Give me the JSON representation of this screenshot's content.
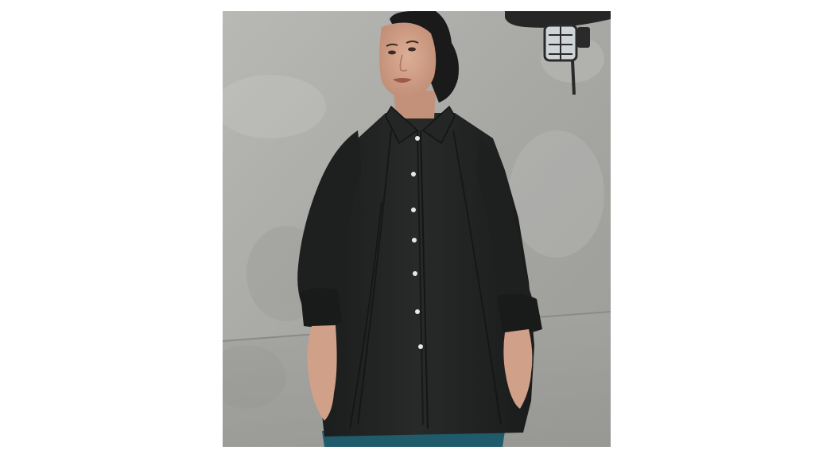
{
  "image": {
    "kind": "product-photo",
    "colors": {
      "page_background": "#ffffff",
      "wall": "#a9a9a7",
      "wall_light": "#c2c2bf",
      "wall_shadow": "#8f8f8d",
      "shirt": "#1f2220",
      "shirt_highlight": "#2f3330",
      "skin": "#d4a48c",
      "skin_shadow": "#b7826b",
      "hijab": "#1a1a1a",
      "trousers": "#1f5b6b",
      "buttons": "#e8e8e8",
      "lamp": "#2a2a2a"
    },
    "icons": [
      "wall-lamp-icon"
    ]
  }
}
